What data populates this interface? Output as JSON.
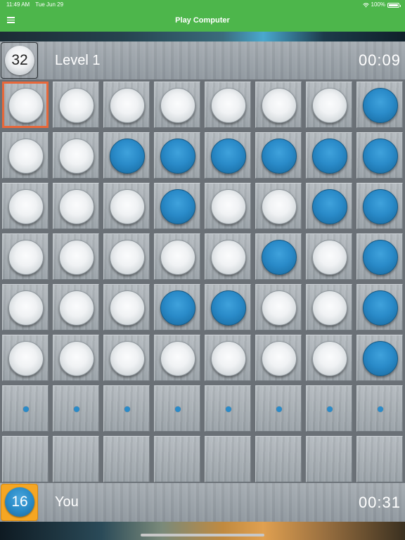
{
  "status_bar": {
    "time": "11:49 AM",
    "date": "Tue Jun 29",
    "battery": "100%"
  },
  "nav": {
    "title": "Play Computer"
  },
  "opponent": {
    "disc_count": "32",
    "label": "Level 1",
    "timer": "00:09"
  },
  "player": {
    "disc_count": "16",
    "label": "You",
    "timer": "00:31"
  },
  "board": {
    "rows": [
      [
        "white",
        "white",
        "white",
        "white",
        "white",
        "white",
        "white",
        "blue"
      ],
      [
        "white",
        "white",
        "blue",
        "blue",
        "blue",
        "blue",
        "blue",
        "blue"
      ],
      [
        "white",
        "white",
        "white",
        "blue",
        "white",
        "white",
        "blue",
        "blue"
      ],
      [
        "white",
        "white",
        "white",
        "white",
        "white",
        "blue",
        "white",
        "blue"
      ],
      [
        "white",
        "white",
        "white",
        "blue",
        "blue",
        "white",
        "white",
        "blue"
      ],
      [
        "white",
        "white",
        "white",
        "white",
        "white",
        "white",
        "white",
        "blue"
      ],
      [
        "hint",
        "hint",
        "hint",
        "hint",
        "hint",
        "hint",
        "hint",
        "hint"
      ],
      [
        "empty",
        "empty",
        "empty",
        "empty",
        "empty",
        "empty",
        "empty",
        "empty"
      ]
    ],
    "selected_cell": {
      "row": 0,
      "col": 0
    }
  },
  "colors": {
    "nav_green": "#4db64b",
    "blue_disc": "#2a8bc9",
    "selected_outline": "#e8683a",
    "player_badge": "#f5a623"
  },
  "icons": {
    "menu": "hamburger-menu-icon",
    "wifi": "wifi-icon",
    "battery": "battery-icon"
  }
}
